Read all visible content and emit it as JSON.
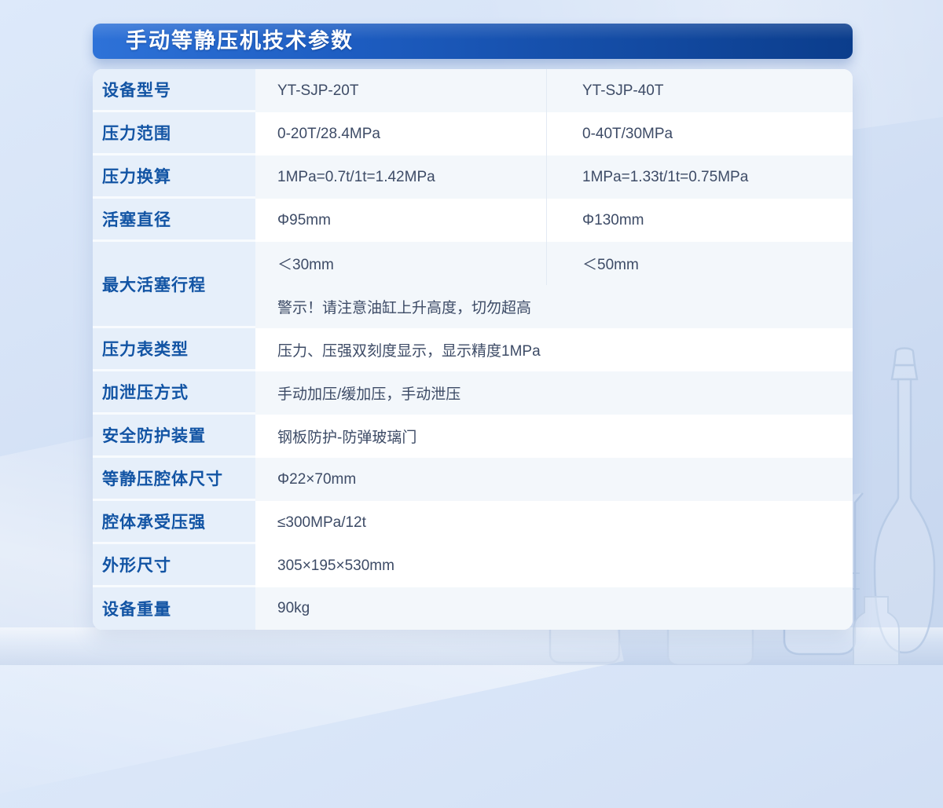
{
  "header": {
    "title": "手动等静压机技术参数"
  },
  "colors": {
    "header_gradient_start": "#2e72d8",
    "header_gradient_end": "#0b3d8c",
    "label_text": "#1254a4",
    "label_bg": "#e6effa",
    "value_text": "#3d4b66",
    "row_tint": "#f3f7fb",
    "page_bg": "#d5e2f6"
  },
  "table": {
    "rows": [
      {
        "label": "设备型号",
        "col1": "YT-SJP-20T",
        "col2": "YT-SJP-40T"
      },
      {
        "label": "压力范围",
        "col1": "0-20T/28.4MPa",
        "col2": "0-40T/30MPa"
      },
      {
        "label": "压力换算",
        "col1": "1MPa=0.7t/1t=1.42MPa",
        "col2": "1MPa=1.33t/1t=0.75MPa"
      },
      {
        "label": "活塞直径",
        "col1": "Φ95mm",
        "col2": "Φ130mm"
      },
      {
        "label": "最大活塞行程",
        "col1": "＜30mm",
        "col2": "＜50mm",
        "note": "警示！请注意油缸上升高度，切勿超高"
      },
      {
        "label": "压力表类型",
        "value": "压力、压强双刻度显示，显示精度1MPa"
      },
      {
        "label": "加泄压方式",
        "value": "手动加压/缓加压，手动泄压"
      },
      {
        "label": "安全防护装置",
        "value": "钢板防护-防弹玻璃门"
      },
      {
        "label": "等静压腔体尺寸",
        "value": "Φ22×70mm"
      },
      {
        "label": "腔体承受压强",
        "value": "≤300MPa/12t"
      },
      {
        "label": "外形尺寸",
        "value": "305×195×530mm"
      },
      {
        "label": "设备重量",
        "value": "90kg"
      }
    ]
  }
}
